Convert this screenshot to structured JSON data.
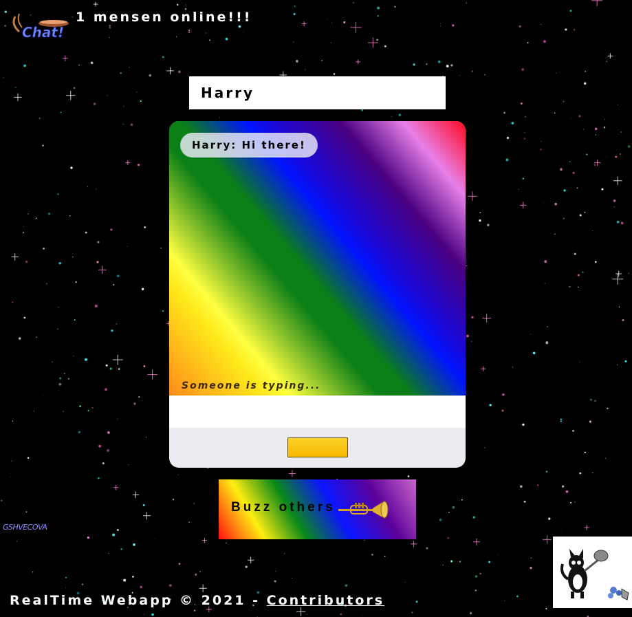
{
  "header": {
    "online_text": "1 mensen online!!!",
    "logo_text": "Chat!"
  },
  "name_input": {
    "value": "Harry"
  },
  "chat": {
    "messages": [
      {
        "author": "Harry",
        "text": "Harry: Hi there!"
      }
    ],
    "typing_indicator": "Someone is typing...",
    "message_input": {
      "value": ""
    },
    "send_button": {
      "label": ""
    }
  },
  "buzz_button": {
    "label": "Buzz others"
  },
  "watermark": "GSHVECOVA",
  "footer": {
    "prefix": "RealTime Webapp © 2021 - ",
    "link_label": "Contributors"
  },
  "colors": {
    "send_button": "#ffc61a",
    "background": "#000000"
  }
}
